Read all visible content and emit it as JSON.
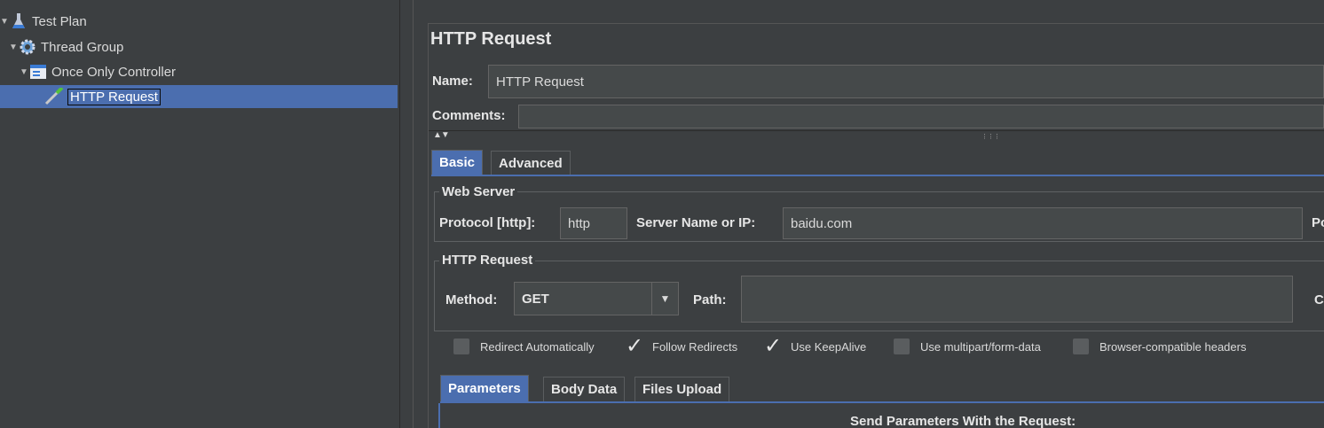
{
  "tree": {
    "items": [
      {
        "label": "Test Plan",
        "icon": "flask-icon"
      },
      {
        "label": "Thread Group",
        "icon": "gear-icon"
      },
      {
        "label": "Once Only Controller",
        "icon": "controller-icon"
      },
      {
        "label": "HTTP Request",
        "icon": "sampler-pipette-icon",
        "selected": true
      }
    ]
  },
  "editor": {
    "title": "HTTP Request",
    "name_label": "Name:",
    "name_value": "HTTP Request",
    "comments_label": "Comments:",
    "comments_value": "",
    "tabs": [
      {
        "label": "Basic",
        "active": true
      },
      {
        "label": "Advanced",
        "active": false
      }
    ],
    "web_server": {
      "title": "Web Server",
      "protocol_label": "Protocol [http]:",
      "protocol_value": "http",
      "server_label": "Server Name or IP:",
      "server_value": "baidu.com",
      "port_label_clipped": "Po"
    },
    "http_request": {
      "title": "HTTP Request",
      "method_label": "Method:",
      "method_value": "GET",
      "path_label": "Path:",
      "path_value": "",
      "encoding_label_clipped": "C"
    },
    "options": [
      {
        "label": "Redirect Automatically",
        "checked": false
      },
      {
        "label": "Follow Redirects",
        "checked": true
      },
      {
        "label": "Use KeepAlive",
        "checked": true
      },
      {
        "label": "Use multipart/form-data",
        "checked": false
      },
      {
        "label": "Browser-compatible headers",
        "checked": false
      }
    ],
    "sub_tabs": [
      {
        "label": "Parameters",
        "active": true
      },
      {
        "label": "Body Data",
        "active": false
      },
      {
        "label": "Files Upload",
        "active": false
      }
    ],
    "parameters_heading": "Send Parameters With the Request:"
  },
  "colors": {
    "background": "#3c3f41",
    "selection": "#4b6eaf",
    "input": "#45494a"
  }
}
